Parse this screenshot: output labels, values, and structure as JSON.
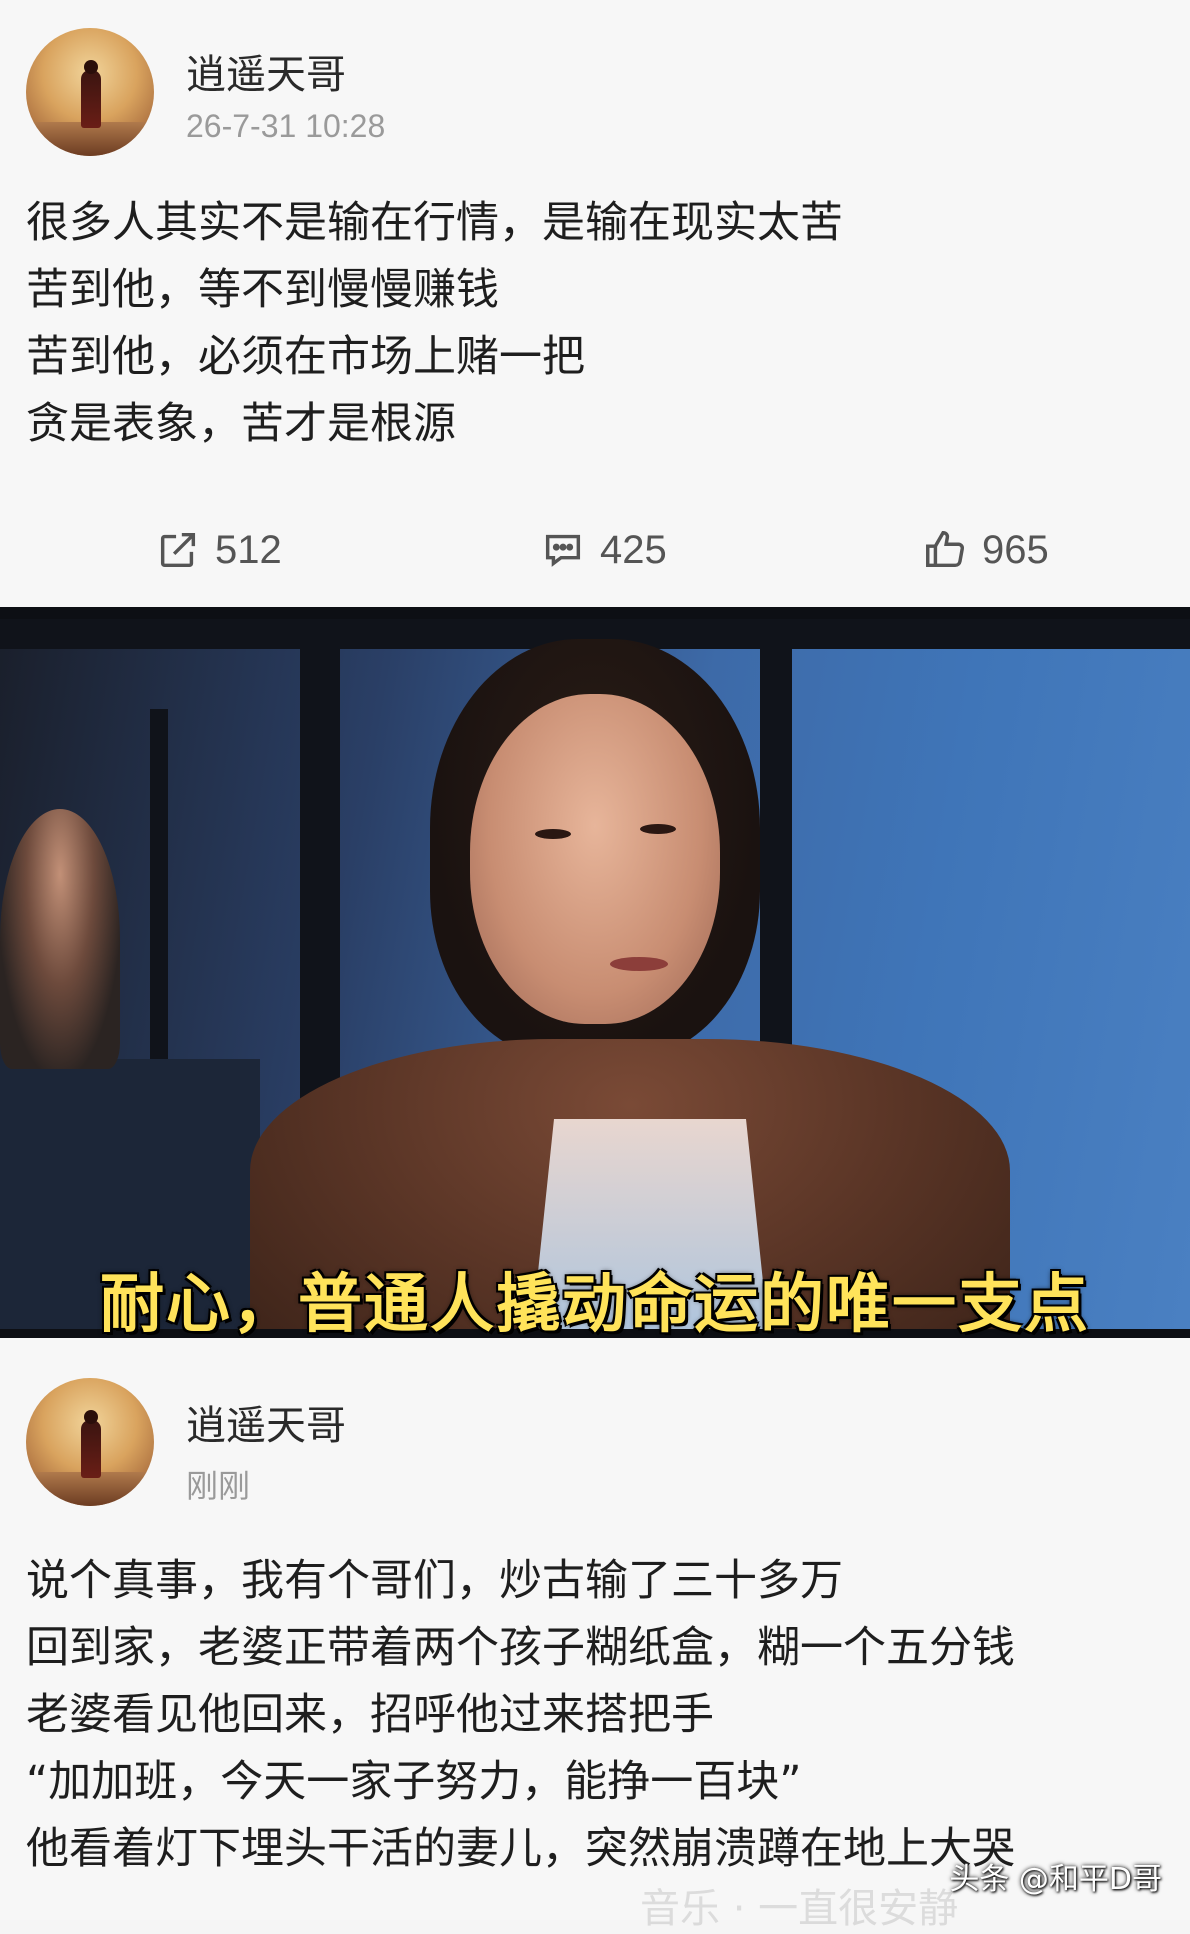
{
  "post1": {
    "author": "逍遥天哥",
    "time": "26-7-31 10:28",
    "lines": [
      "很多人其实不是输在行情，是输在现实太苦",
      "苦到他，等不到慢慢赚钱",
      "苦到他，必须在市场上赌一把",
      "贪是表象，苦才是根源"
    ],
    "actions": {
      "share_icon": "share-icon",
      "share_count": "512",
      "comment_icon": "comment-icon",
      "comment_count": "425",
      "like_icon": "thumbs-up-icon",
      "like_count": "965"
    }
  },
  "video": {
    "caption": "耐心，普通人撬动命运的唯一支点"
  },
  "post2": {
    "author": "逍遥天哥",
    "time": "刚刚",
    "lines": [
      "说个真事，我有个哥们，炒古输了三十多万",
      "回到家，老婆正带着两个孩子糊纸盒，糊一个五分钱",
      "老婆看见他回来，招呼他过来搭把手",
      "“加加班，今天一家子努力，能挣一百块”",
      "他看着灯下埋头干活的妻儿，突然崩溃蹲在地上大哭"
    ],
    "ghost_text": "音乐 · 一直很安静"
  },
  "watermark": "头条 @和平D哥"
}
